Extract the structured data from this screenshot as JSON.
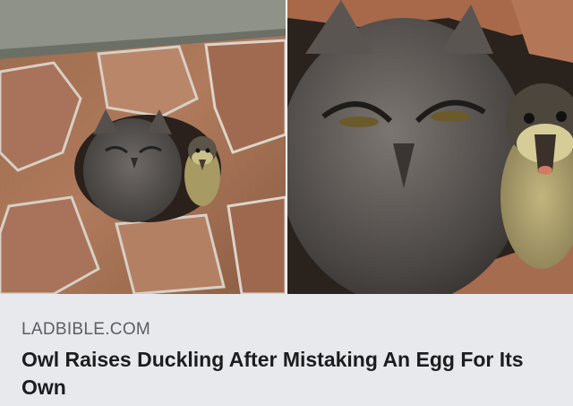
{
  "images": [
    {
      "alt": "Screech owl and duckling peering out of a tree cavity"
    },
    {
      "alt": "Close-up of the owl with the duckling beside it"
    }
  ],
  "link_preview": {
    "source": "LADBIBLE.COM",
    "headline": "Owl Raises Duckling After Mistaking An Egg For Its Own"
  },
  "colors": {
    "caption_background": "#e7e9ec",
    "source_text": "#5b5e63",
    "headline_text": "#1c1d1f"
  }
}
